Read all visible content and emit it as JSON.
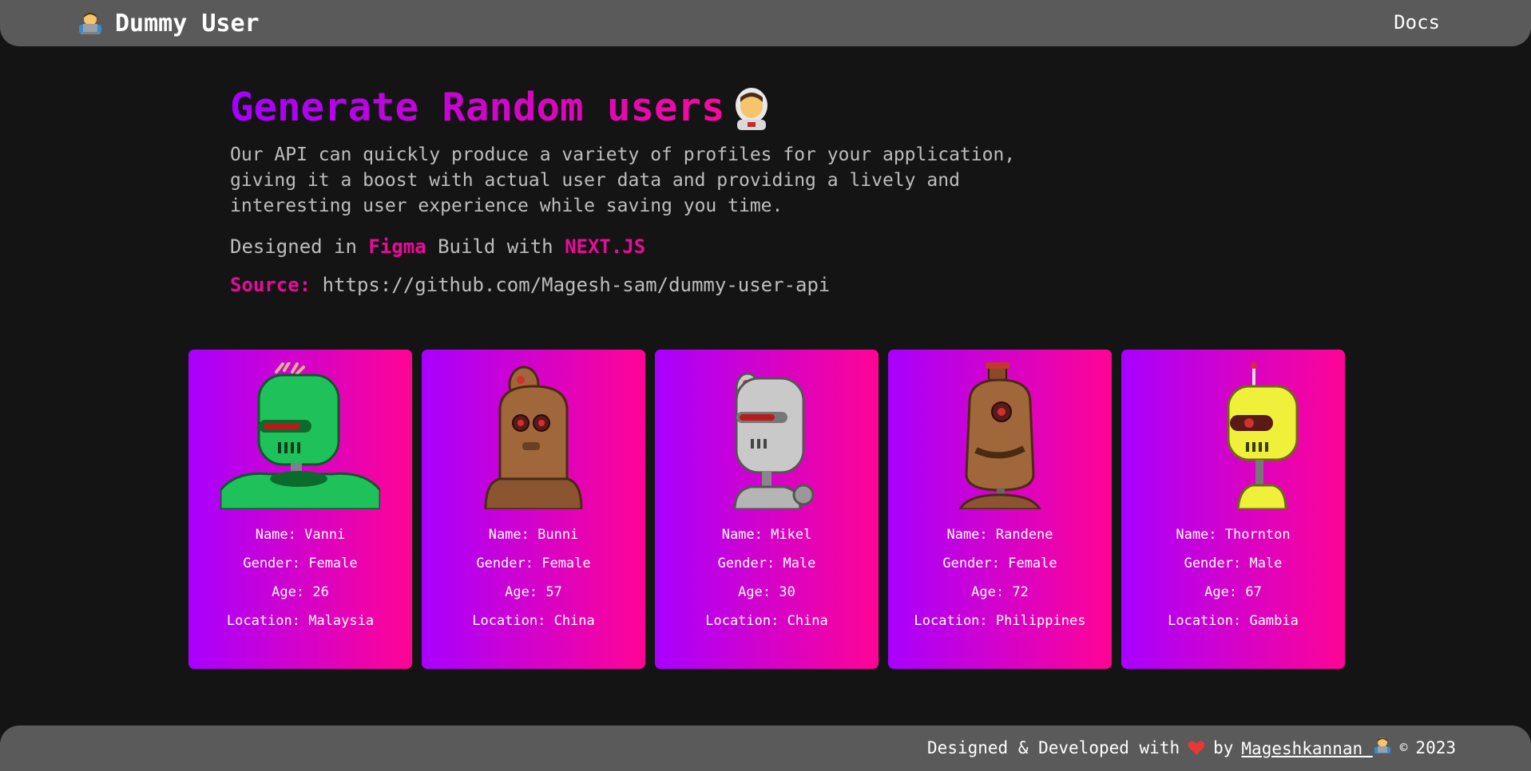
{
  "nav": {
    "brand": "Dummy User",
    "docs_label": "Docs"
  },
  "hero": {
    "title": "Generate Random users",
    "description": "Our API can quickly produce a variety of profiles for your application, giving it a boost with actual user data and providing a lively and interesting user experience while saving you time.",
    "designed_prefix": "Designed in",
    "designed_tool": "Figma",
    "build_prefix": "Build with",
    "build_tool": "NEXT.JS",
    "source_label": "Source:",
    "source_url": "https://github.com/Magesh-sam/dummy-user-api"
  },
  "users": [
    {
      "name": "Name: Vanni",
      "gender": "Gender: Female",
      "age": "Age: 26",
      "location": "Location: Malaysia",
      "avatar_icon": "green-robot-icon"
    },
    {
      "name": "Name: Bunni",
      "gender": "Gender: Female",
      "age": "Age: 57",
      "location": "Location: China",
      "avatar_icon": "brown-robot-icon"
    },
    {
      "name": "Name: Mikel",
      "gender": "Gender: Male",
      "age": "Age: 30",
      "location": "Location: China",
      "avatar_icon": "silver-robot-icon"
    },
    {
      "name": "Name: Randene",
      "gender": "Gender: Female",
      "age": "Age: 72",
      "location": "Location: Philippines",
      "avatar_icon": "brown-robot-icon"
    },
    {
      "name": "Name: Thornton",
      "gender": "Gender: Male",
      "age": "Age: 67",
      "location": "Location: Gambia",
      "avatar_icon": "yellow-robot-icon"
    }
  ],
  "footer": {
    "prefix": "Designed & Developed with",
    "by": "by",
    "author": "Mageshkannan",
    "copyright": "©",
    "year": "2023"
  },
  "colors": {
    "accent_purple": "#a800ff",
    "accent_pink": "#ff0495",
    "header_bg": "#5a5a5a",
    "page_bg": "#141414"
  }
}
